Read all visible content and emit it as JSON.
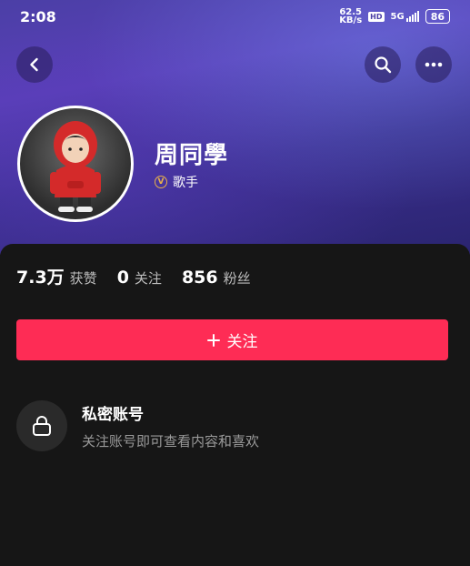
{
  "status_bar": {
    "time": "2:08",
    "speed_value": "62.5",
    "speed_unit": "KB/s",
    "hd_label": "HD",
    "network": "5G",
    "battery": "86"
  },
  "nav": {
    "back_icon": "chevron-left-icon",
    "search_icon": "search-icon",
    "more_icon": "more-horizontal-icon"
  },
  "profile": {
    "display_name": "周同學",
    "verify_badge": "V",
    "verify_label": "歌手"
  },
  "stats": [
    {
      "value": "7.3万",
      "label": "获赞"
    },
    {
      "value": "0",
      "label": "关注"
    },
    {
      "value": "856",
      "label": "粉丝"
    }
  ],
  "follow_button": {
    "label": "关注"
  },
  "private_account": {
    "title": "私密账号",
    "description": "关注账号即可查看内容和喜欢"
  },
  "colors": {
    "accent": "#fe2c55",
    "header_purple": "#4b3fa6",
    "background": "#161616",
    "verify_gold": "#e8b04b"
  }
}
